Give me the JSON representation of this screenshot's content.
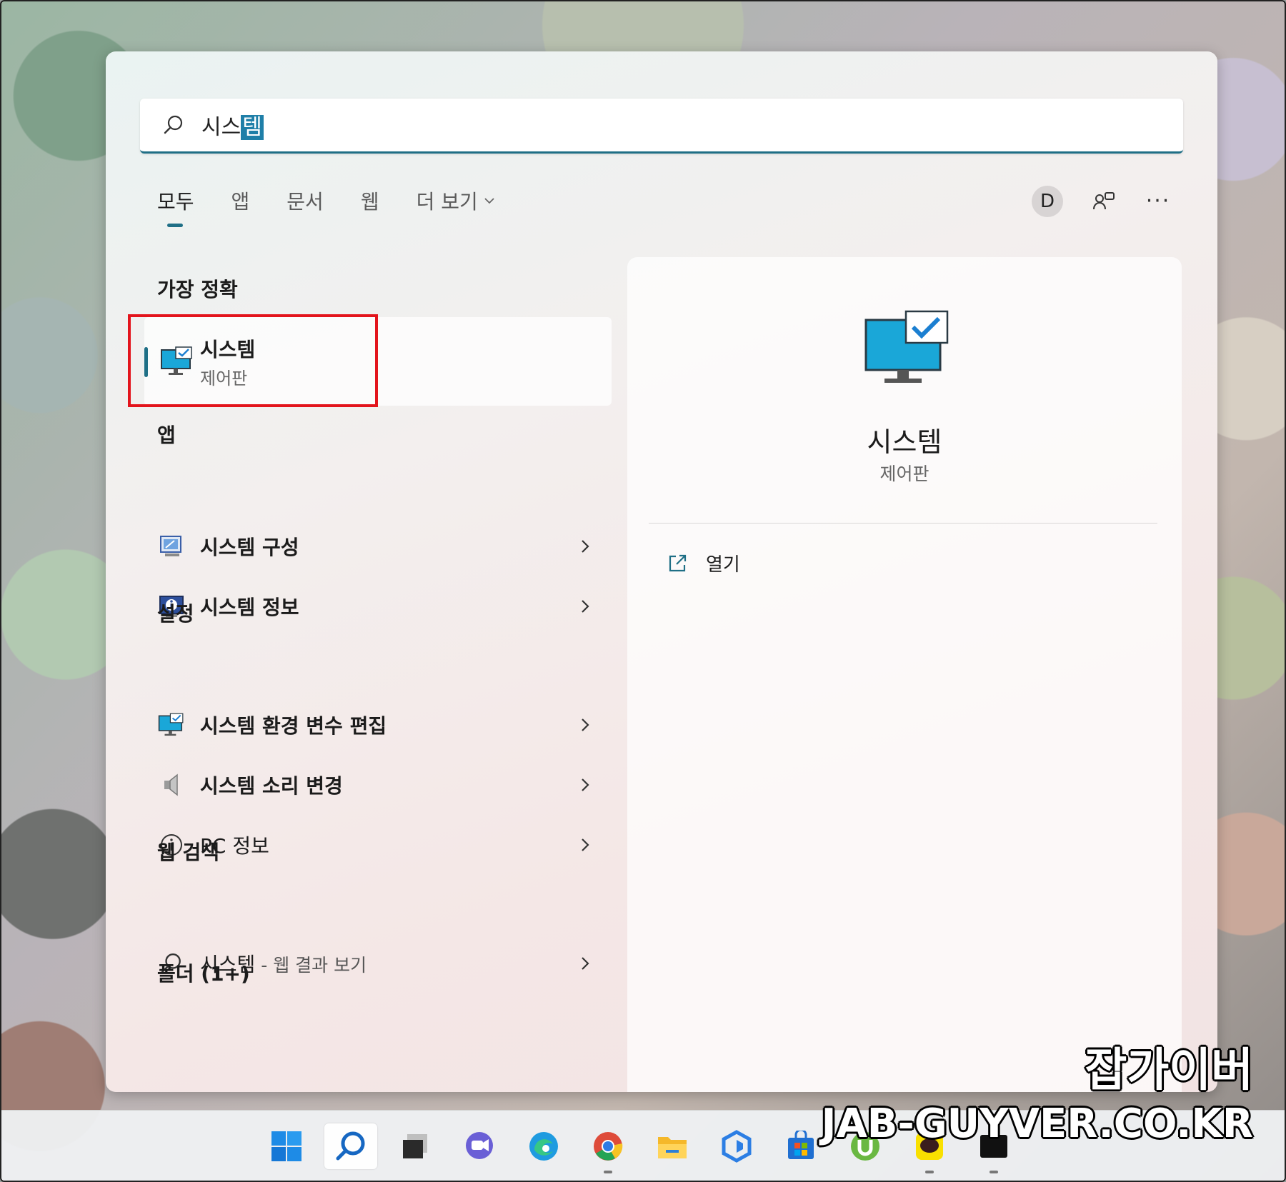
{
  "search": {
    "query_prefix": "시스",
    "query_selected": "템"
  },
  "tabs": [
    {
      "label": "모두",
      "active": true
    },
    {
      "label": "앱"
    },
    {
      "label": "문서"
    },
    {
      "label": "웹"
    },
    {
      "label": "더 보기"
    }
  ],
  "account": {
    "avatar_letter": "D"
  },
  "more_label": "···",
  "sections": {
    "best_match": "가장 정확",
    "apps": "앱",
    "settings": "설정",
    "web": "웹 검색",
    "folders": "폴더 (1+)"
  },
  "best_match": {
    "title": "시스템",
    "subtitle": "제어판"
  },
  "apps": [
    {
      "label": "시스템 구성",
      "icon": "msconfig-icon"
    },
    {
      "label": "시스템 정보",
      "icon": "system-info-icon"
    }
  ],
  "settings": [
    {
      "label": "시스템 환경 변수 편집",
      "icon": "monitor-check-icon"
    },
    {
      "label": "시스템 소리 변경",
      "icon": "speaker-icon"
    },
    {
      "label": "PC 정보",
      "icon": "info-circle-icon"
    }
  ],
  "web": {
    "label": "시스템",
    "suffix": " - 웹 결과 보기"
  },
  "preview": {
    "title": "시스템",
    "subtitle": "제어판",
    "open_label": "열기"
  },
  "watermark": {
    "line1": "잡가이버",
    "line2": "JAB-GUYVER.CO.KR"
  },
  "taskbar": [
    "start-icon",
    "search-icon",
    "task-view-icon",
    "chat-icon",
    "edge-icon",
    "chrome-icon",
    "file-explorer-icon",
    "app-icon",
    "store-icon",
    "utorrent-icon",
    "kakaotalk-icon",
    "terminal-icon"
  ],
  "colors": {
    "accent": "#1f6f86",
    "highlight_border": "#e3141c"
  }
}
